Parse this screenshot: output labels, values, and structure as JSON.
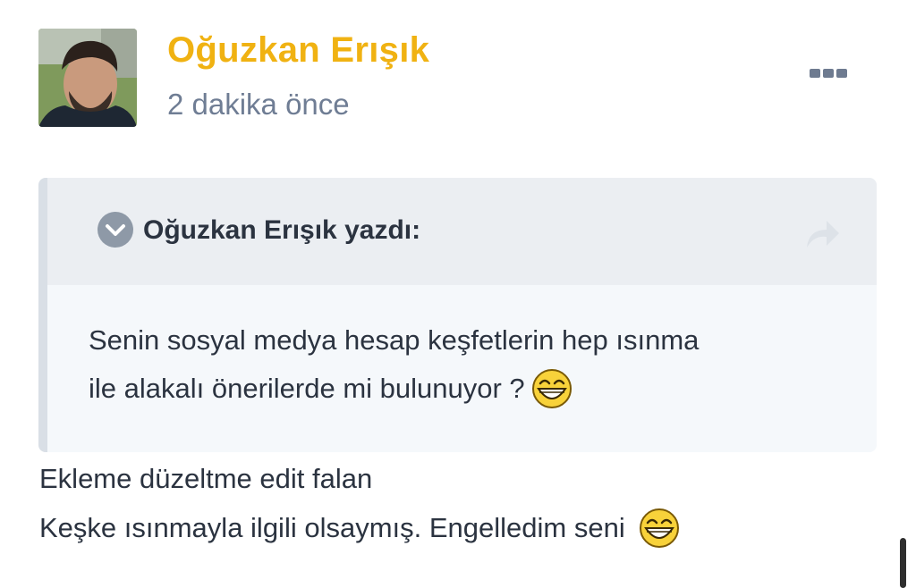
{
  "post": {
    "username": "Oğuzkan Erışık",
    "timestamp": "2 dakika önce",
    "more_icon": "more-horizontal-icon"
  },
  "quote": {
    "author_line": "Oğuzkan Erışık yazdı:",
    "lines": [
      "Senin sosyal medya hesap keşfetlerin hep ısınma",
      "ile alakalı önerilerde mi bulunuyor ?"
    ],
    "expand_icon": "chevron-down-circle-icon",
    "share_icon": "share-arrow-icon"
  },
  "reply": {
    "lines": [
      "Ekleme düzeltme edit falan",
      "Keşke ısınmayla ilgili olsaymış. Engelledim seni "
    ]
  },
  "colors": {
    "username": "#f0b212",
    "timestamp": "#6f7d94",
    "quote_bg": "#f5f8fb",
    "quote_header_bg": "#ebeef2",
    "text": "#2b3340"
  }
}
